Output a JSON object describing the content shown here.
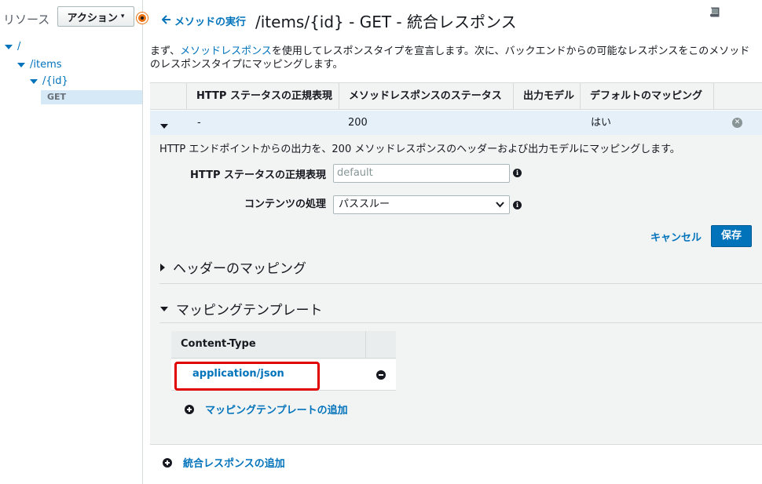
{
  "sidebar": {
    "title": "リソース",
    "action_label": "アクション",
    "tree": {
      "root": "/",
      "items": "/items",
      "id": "/{id}",
      "get": "GET"
    }
  },
  "header": {
    "back_label": "メソッドの実行",
    "title": "/items/{id} - GET - 統合レスポンス"
  },
  "intro": {
    "before_link": "まず、",
    "link": "メソッドレスポンス",
    "after_link": "を使用してレスポンスタイプを宣言します。次に、バックエンドからの可能なレスポンスをこのメソッドのレスポンスタイプにマッピングします。"
  },
  "table": {
    "headers": [
      "HTTP ステータスの正規表現",
      "メソッドレスポンスのステータス",
      "出力モデル",
      "デフォルトのマッピング"
    ],
    "row": {
      "regex": "-",
      "status": "200",
      "model": "",
      "default": "はい"
    }
  },
  "detail": {
    "description": "HTTP エンドポイントからの出力を、200 メソッドレスポンスのヘッダーおよび出力モデルにマッピングします。",
    "regex_label": "HTTP ステータスの正規表現",
    "regex_placeholder": "default",
    "content_label": "コンテンツの処理",
    "content_value": "パススルー",
    "cancel_label": "キャンセル",
    "save_label": "保存"
  },
  "header_mapping": {
    "title": "ヘッダーのマッピング"
  },
  "mapping_templates": {
    "title": "マッピングテンプレート",
    "column": "Content-Type",
    "rows": [
      "application/json"
    ],
    "add_label": "マッピングテンプレートの追加"
  },
  "add_response_label": "統合レスポンスの追加",
  "colors": {
    "accent": "#0073bb",
    "highlight": "#e00000",
    "orange": "#ec7211"
  }
}
